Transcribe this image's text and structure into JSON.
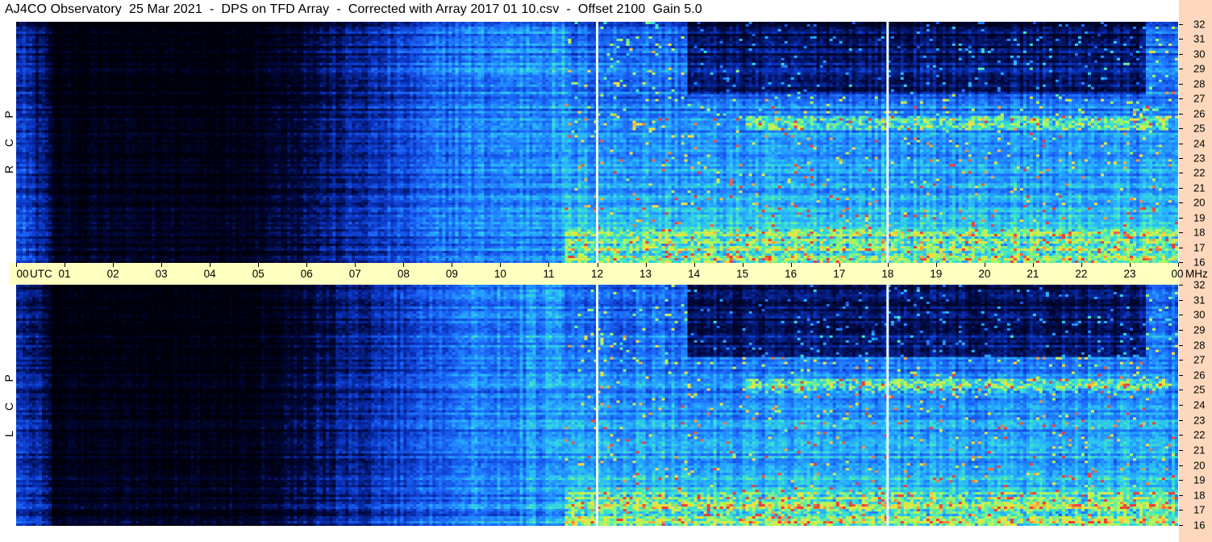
{
  "title": "AJ4CO Observatory  25 Mar 2021  -  DPS on TFD Array  -  Corrected with Array 2017 01 10.csv  -  Offset 2100  Gain 5.0",
  "panels": {
    "rcp": {
      "label_letters": [
        "R",
        "C",
        "P"
      ]
    },
    "lcp": {
      "label_letters": [
        "L",
        "C",
        "P"
      ]
    }
  },
  "time_axis": {
    "labels": [
      "00",
      "01",
      "02",
      "03",
      "04",
      "05",
      "06",
      "07",
      "08",
      "09",
      "10",
      "11",
      "12",
      "13",
      "14",
      "15",
      "16",
      "17",
      "18",
      "19",
      "20",
      "21",
      "22",
      "23",
      "00"
    ],
    "unit": "UTC"
  },
  "freq_axis": {
    "labels": [
      "32",
      "31",
      "30",
      "29",
      "28",
      "27",
      "26",
      "25",
      "24",
      "23",
      "22",
      "21",
      "20",
      "19",
      "18",
      "17",
      "16"
    ],
    "unit": "MHz"
  },
  "colors": {
    "axis_time_bg": "#ffffc0",
    "axis_freq_bg": "#fdd8bc",
    "spectrogram_low": "#000010",
    "spectrogram_mid": "#1e5aff",
    "spectrogram_high": "#ffe050"
  }
}
